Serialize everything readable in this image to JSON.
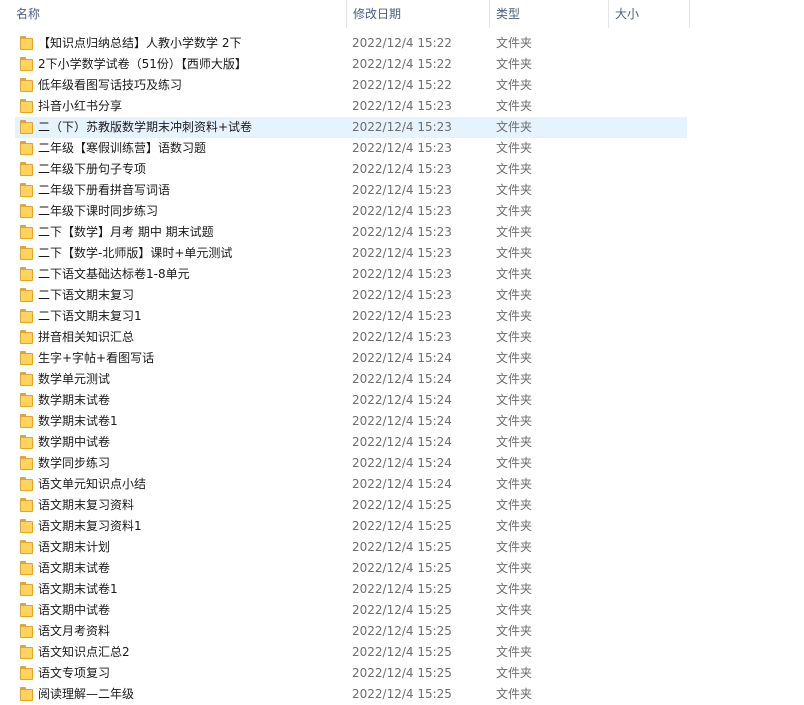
{
  "columns": {
    "name": "名称",
    "date": "修改日期",
    "type": "类型",
    "size": "大小"
  },
  "sort_indicator": "^",
  "selected_index": 4,
  "colors": {
    "selection": "#e5f3ff",
    "folder": "#ffd35c",
    "header_text": "#4c607a",
    "meta_text": "#6d6d6d"
  },
  "files": [
    {
      "name": "【知识点归纳总结】人教小学数学 2下",
      "date": "2022/12/4 15:22",
      "type": "文件夹",
      "icon": "folder-icon"
    },
    {
      "name": "2下小学数学试卷（51份）【西师大版】",
      "date": "2022/12/4 15:22",
      "type": "文件夹",
      "icon": "folder-icon"
    },
    {
      "name": "低年级看图写话技巧及练习",
      "date": "2022/12/4 15:22",
      "type": "文件夹",
      "icon": "folder-icon"
    },
    {
      "name": "抖音小红书分享",
      "date": "2022/12/4 15:23",
      "type": "文件夹",
      "icon": "folder-icon"
    },
    {
      "name": "二（下）苏教版数学期末冲刺资料+试卷",
      "date": "2022/12/4 15:23",
      "type": "文件夹",
      "icon": "folder-icon"
    },
    {
      "name": "二年级【寒假训练营】语数习题",
      "date": "2022/12/4 15:23",
      "type": "文件夹",
      "icon": "folder-icon"
    },
    {
      "name": "二年级下册句子专项",
      "date": "2022/12/4 15:23",
      "type": "文件夹",
      "icon": "folder-icon"
    },
    {
      "name": "二年级下册看拼音写词语",
      "date": "2022/12/4 15:23",
      "type": "文件夹",
      "icon": "folder-icon"
    },
    {
      "name": "二年级下课时同步练习",
      "date": "2022/12/4 15:23",
      "type": "文件夹",
      "icon": "folder-icon"
    },
    {
      "name": "二下【数学】月考 期中 期末试题",
      "date": "2022/12/4 15:23",
      "type": "文件夹",
      "icon": "folder-icon"
    },
    {
      "name": "二下【数学-北师版】课时+单元测试",
      "date": "2022/12/4 15:23",
      "type": "文件夹",
      "icon": "folder-icon"
    },
    {
      "name": "二下语文基础达标卷1-8单元",
      "date": "2022/12/4 15:23",
      "type": "文件夹",
      "icon": "folder-icon"
    },
    {
      "name": "二下语文期末复习",
      "date": "2022/12/4 15:23",
      "type": "文件夹",
      "icon": "folder-icon"
    },
    {
      "name": "二下语文期末复习1",
      "date": "2022/12/4 15:23",
      "type": "文件夹",
      "icon": "folder-icon"
    },
    {
      "name": "拼音相关知识汇总",
      "date": "2022/12/4 15:23",
      "type": "文件夹",
      "icon": "folder-icon"
    },
    {
      "name": "生字+字帖+看图写话",
      "date": "2022/12/4 15:24",
      "type": "文件夹",
      "icon": "folder-icon"
    },
    {
      "name": "数学单元测试",
      "date": "2022/12/4 15:24",
      "type": "文件夹",
      "icon": "folder-icon"
    },
    {
      "name": "数学期末试卷",
      "date": "2022/12/4 15:24",
      "type": "文件夹",
      "icon": "folder-icon"
    },
    {
      "name": "数学期末试卷1",
      "date": "2022/12/4 15:24",
      "type": "文件夹",
      "icon": "folder-icon"
    },
    {
      "name": "数学期中试卷",
      "date": "2022/12/4 15:24",
      "type": "文件夹",
      "icon": "folder-icon"
    },
    {
      "name": "数学同步练习",
      "date": "2022/12/4 15:24",
      "type": "文件夹",
      "icon": "folder-icon"
    },
    {
      "name": "语文单元知识点小结",
      "date": "2022/12/4 15:24",
      "type": "文件夹",
      "icon": "folder-icon"
    },
    {
      "name": "语文期末复习资料",
      "date": "2022/12/4 15:25",
      "type": "文件夹",
      "icon": "folder-icon"
    },
    {
      "name": "语文期末复习资料1",
      "date": "2022/12/4 15:25",
      "type": "文件夹",
      "icon": "folder-icon"
    },
    {
      "name": "语文期末计划",
      "date": "2022/12/4 15:25",
      "type": "文件夹",
      "icon": "folder-icon"
    },
    {
      "name": "语文期末试卷",
      "date": "2022/12/4 15:25",
      "type": "文件夹",
      "icon": "folder-icon"
    },
    {
      "name": "语文期末试卷1",
      "date": "2022/12/4 15:25",
      "type": "文件夹",
      "icon": "folder-icon"
    },
    {
      "name": "语文期中试卷",
      "date": "2022/12/4 15:25",
      "type": "文件夹",
      "icon": "folder-icon"
    },
    {
      "name": "语文月考资料",
      "date": "2022/12/4 15:25",
      "type": "文件夹",
      "icon": "folder-icon"
    },
    {
      "name": "语文知识点汇总2",
      "date": "2022/12/4 15:25",
      "type": "文件夹",
      "icon": "folder-icon"
    },
    {
      "name": "语文专项复习",
      "date": "2022/12/4 15:25",
      "type": "文件夹",
      "icon": "folder-icon"
    },
    {
      "name": "阅读理解—二年级",
      "date": "2022/12/4 15:25",
      "type": "文件夹",
      "icon": "folder-icon"
    }
  ]
}
